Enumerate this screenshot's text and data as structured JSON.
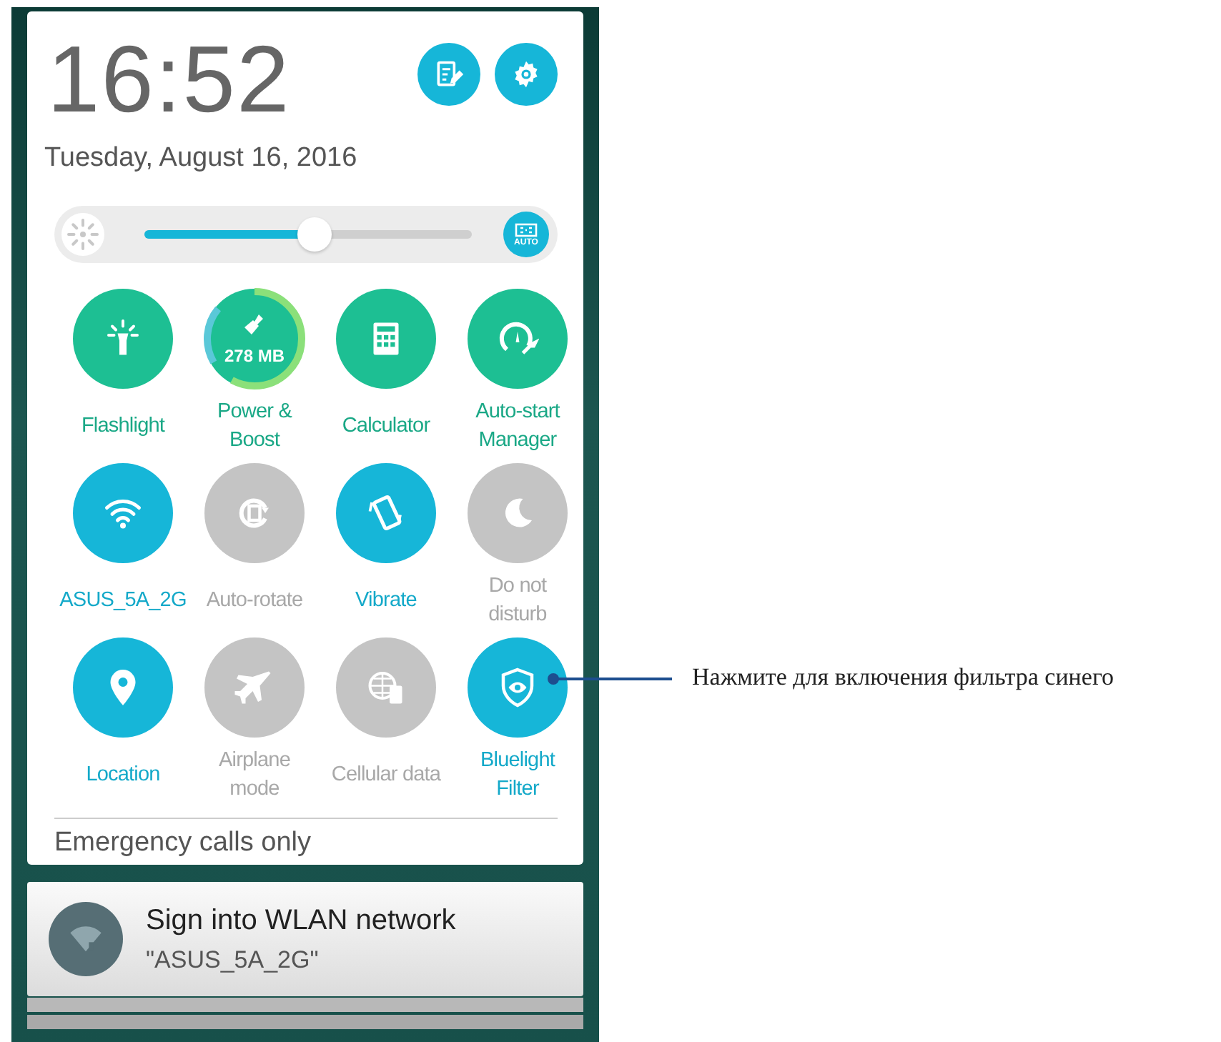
{
  "clock": {
    "time": "16:52",
    "date": "Tuesday, August 16, 2016"
  },
  "header_buttons": [
    {
      "kind": "edit"
    },
    {
      "kind": "settings"
    }
  ],
  "brightness": {
    "level": 0.52,
    "auto": {
      "label": "AUTO",
      "on": true
    }
  },
  "tiles": [
    {
      "kind": "shortcut",
      "label": "Flashlight"
    },
    {
      "kind": "shortcut",
      "label": "Power & Boost",
      "badge": "278 MB"
    },
    {
      "kind": "shortcut",
      "label": "Calculator"
    },
    {
      "kind": "shortcut",
      "label": "Auto-start Manager"
    },
    {
      "kind": "toggle",
      "label": "ASUS_5A_2G",
      "on": true
    },
    {
      "kind": "toggle",
      "label": "Auto-rotate",
      "on": false
    },
    {
      "kind": "toggle",
      "label": "Vibrate",
      "on": true
    },
    {
      "kind": "toggle",
      "label": "Do not disturb",
      "on": false
    },
    {
      "kind": "toggle",
      "label": "Location",
      "on": true
    },
    {
      "kind": "toggle",
      "label": "Airplane mode",
      "on": false
    },
    {
      "kind": "toggle",
      "label": "Cellular data",
      "on": false
    },
    {
      "kind": "toggle",
      "label": "Bluelight Filter",
      "on": true
    }
  ],
  "status": "Emergency calls only",
  "notification": {
    "title": "Sign into WLAN network",
    "subtitle": "\"ASUS_5A_2G\""
  },
  "callout": {
    "text": "Нажмите для включения фильтра синего"
  }
}
